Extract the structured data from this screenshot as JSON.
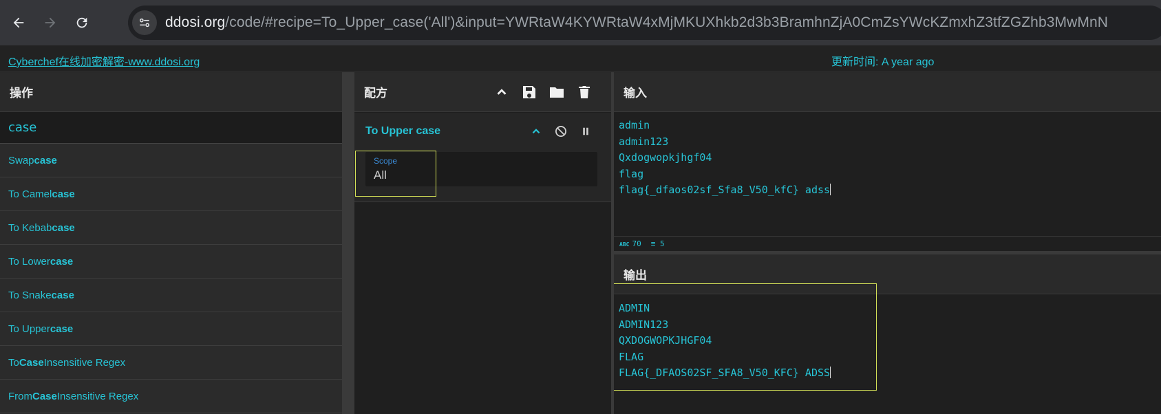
{
  "browser": {
    "url_host": "ddosi.org",
    "url_path": "/code/#recipe=To_Upper_case('All')&input=YWRtaW4KYWRtaW4xMjMKUXhkb2d3b3BramhnZjA0CmZsYWcKZmxhZ3tfZGZhb3MwMnN"
  },
  "banner": {
    "link_text": "Cyberchef在线加密解密-www.ddosi.org",
    "update_text": "更新时间: A year ago"
  },
  "operations": {
    "title": "操作",
    "search_value": "case",
    "items": [
      {
        "pre": "Swap ",
        "match": "case",
        "post": ""
      },
      {
        "pre": "To Camel ",
        "match": "case",
        "post": ""
      },
      {
        "pre": "To Kebab ",
        "match": "case",
        "post": ""
      },
      {
        "pre": "To Lower ",
        "match": "case",
        "post": ""
      },
      {
        "pre": "To Snake ",
        "match": "case",
        "post": ""
      },
      {
        "pre": "To Upper ",
        "match": "case",
        "post": ""
      },
      {
        "pre": "To ",
        "match": "Case",
        "post": " Insensitive Regex"
      },
      {
        "pre": "From ",
        "match": "Case",
        "post": " Insensitive Regex"
      }
    ]
  },
  "recipe": {
    "title": "配方",
    "ingredient": {
      "name": "To Upper case",
      "scope_label": "Scope",
      "scope_value": "All"
    }
  },
  "input": {
    "title": "输入",
    "lines": [
      "admin",
      "admin123",
      "Qxdogwopkjhgf04",
      "flag",
      "flag{_dfaos02sf_Sfa8_V50_kfC} adss"
    ],
    "char_count": "70",
    "line_count": "5",
    "badge": "ABC"
  },
  "output": {
    "title": "输出",
    "lines": [
      "ADMIN",
      "ADMIN123",
      "QXDOGWOPKJHGF04",
      "FLAG",
      "FLAG{_DFAOS02SF_SFA8_V50_KFC} ADSS"
    ]
  },
  "colors": {
    "accent": "#27c4d6",
    "highlight": "#d4e157"
  }
}
